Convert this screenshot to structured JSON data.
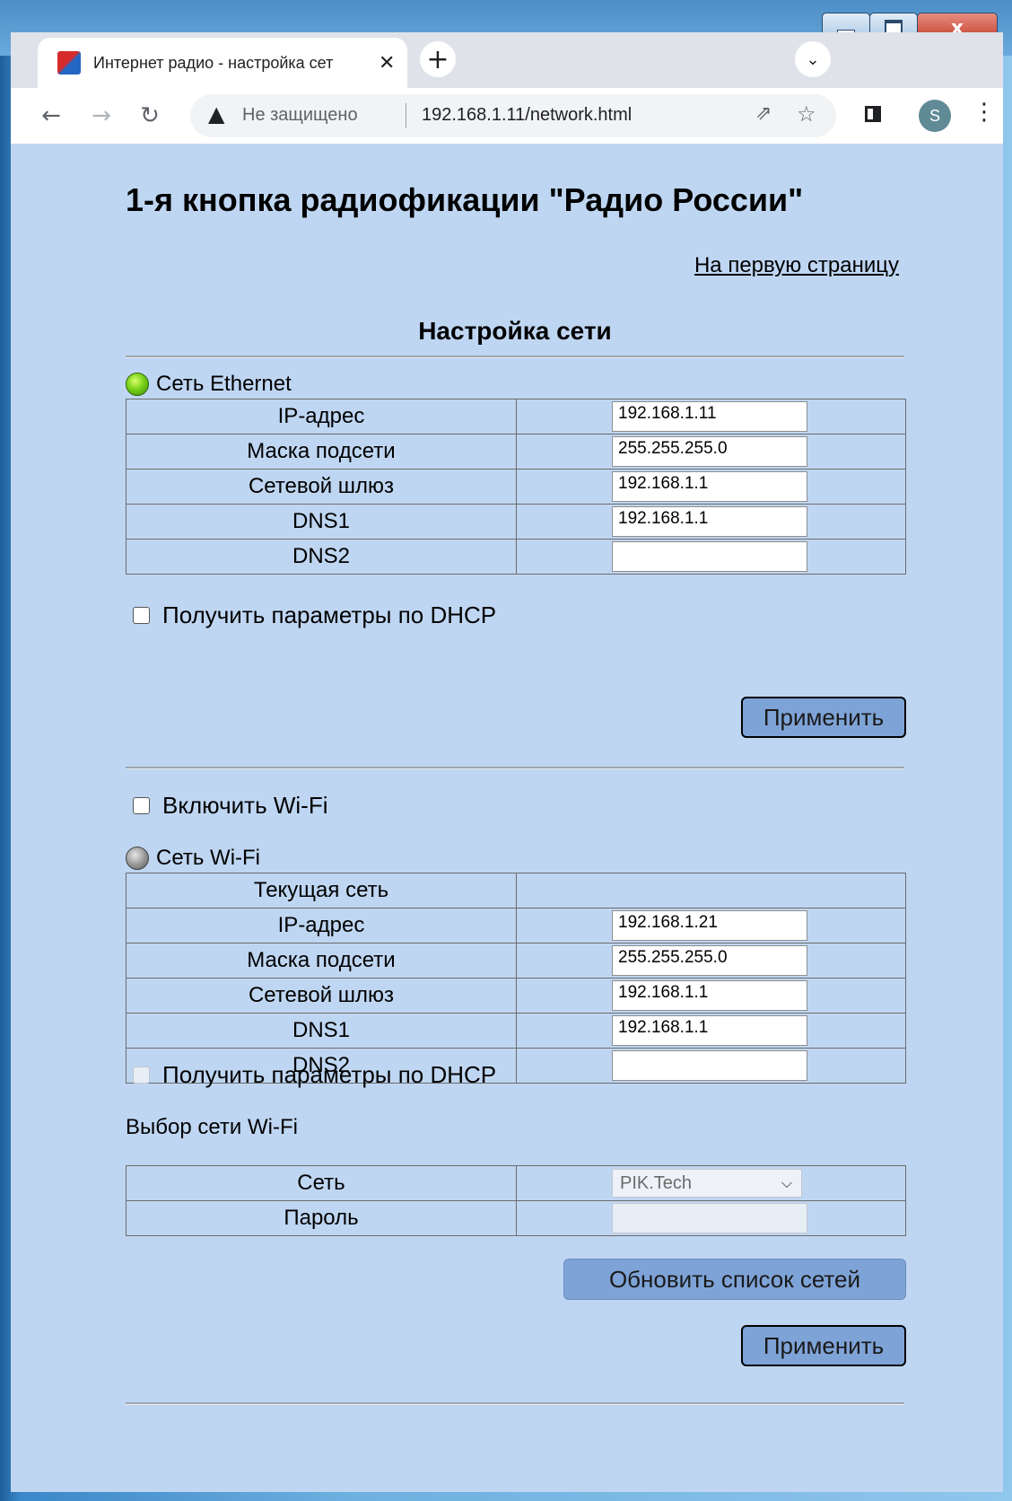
{
  "browser": {
    "tab_title": "Интернет радио - настройка сет",
    "tab_close": "✕",
    "new_tab": "+",
    "tab_search": "⌄",
    "back": "←",
    "forward": "→",
    "reload": "↻",
    "security_icon": "▲",
    "security_label": "Не защищено",
    "url": "192.168.1.11/network.html",
    "share": "⇗",
    "bookmark": "☆",
    "profile_initial": "S",
    "menu": "⋮"
  },
  "window": {
    "minimize": "",
    "maximize": "",
    "close": "x"
  },
  "page": {
    "title": "1-я кнопка радиофикации \"Радио России\"",
    "home_link": "На первую страницу",
    "section_title": "Настройка сети"
  },
  "ethernet": {
    "status_label": "Сеть Ethernet",
    "status_color": "#78d21a",
    "rows": [
      {
        "label": "IP-адрес",
        "value": "192.168.1.11"
      },
      {
        "label": "Маска подсети",
        "value": "255.255.255.0"
      },
      {
        "label": "Сетевой шлюз",
        "value": "192.168.1.1"
      },
      {
        "label": "DNS1",
        "value": "192.168.1.1"
      },
      {
        "label": "DNS2",
        "value": ""
      }
    ],
    "dhcp_label": "Получить параметры по DHCP",
    "dhcp_checked": false,
    "apply_label": "Применить"
  },
  "wifi": {
    "enable_label": "Включить Wi-Fi",
    "enable_checked": false,
    "status_label": "Сеть Wi-Fi",
    "status_color": "#9a9a9a",
    "current_network_label": "Текущая сеть",
    "current_network_value": "",
    "rows": [
      {
        "label": "IP-адрес",
        "value": "192.168.1.21"
      },
      {
        "label": "Маска подсети",
        "value": "255.255.255.0"
      },
      {
        "label": "Сетевой шлюз",
        "value": "192.168.1.1"
      },
      {
        "label": "DNS1",
        "value": "192.168.1.1"
      },
      {
        "label": "DNS2",
        "value": ""
      }
    ],
    "dhcp_label": "Получить параметры по DHCP",
    "select_title": "Выбор сети Wi-Fi",
    "network_label": "Сеть",
    "network_value": "PIK.Tech",
    "password_label": "Пароль",
    "password_value": "",
    "refresh_label": "Обновить список сетей",
    "apply_label": "Применить"
  },
  "colors": {
    "page_background": "#bfd6f2",
    "button_background": "#7ea3d7"
  }
}
